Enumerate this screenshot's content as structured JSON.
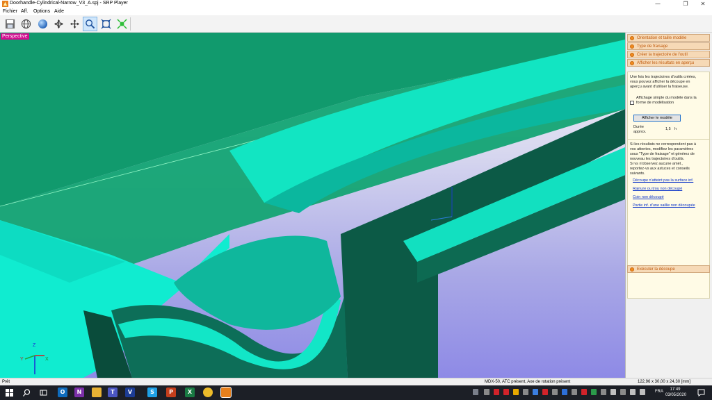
{
  "window": {
    "title": "Doorhandle-Cylindrical-Narrow_V3_A.spj - SRP Player",
    "minimize_icon": "minimize-icon",
    "maximize_icon": "restore-icon",
    "close_icon": "close-icon"
  },
  "menu": {
    "items": [
      "Fichier",
      "Aff.",
      "Options",
      "Aide"
    ]
  },
  "toolbar": {
    "buttons": [
      {
        "icon": "save-icon"
      },
      {
        "icon": "globe-grid-icon"
      },
      {
        "icon": "sphere-icon"
      },
      {
        "icon": "rotate-move-icon"
      },
      {
        "icon": "pan-icon"
      },
      {
        "icon": "zoom-icon"
      },
      {
        "icon": "fit-window-icon"
      },
      {
        "icon": "fit-selection-icon"
      }
    ],
    "active_index": 5
  },
  "viewport": {
    "view_label": "Perspective",
    "axis_labels": [
      "Z",
      "Y",
      "X"
    ]
  },
  "panel": {
    "steps": [
      "Orientation et taille modèle",
      "Type de fraisage",
      "Créer la trajectoire de l'outil",
      "Afficher les résultats en aperçu"
    ],
    "info_intro": [
      "Une fois les trajectoires d'outils créées,",
      "vous pouvez afficher la découpe en",
      "aperçu avant d'utiliser la fraiseuse."
    ],
    "checkbox_label": [
      "Affichage simple du modèle dans la",
      "forme de modélisation"
    ],
    "preview_button": "Afficher le modèle",
    "duration_label": [
      "Durée",
      "approx."
    ],
    "duration_value": "1,5",
    "duration_unit": "h",
    "advice_text": [
      "Si les résultats ne correspondent pas à",
      "vos attentes, modifiez les paramètres",
      "sous \"Type de fraisage\" et générez de",
      "nouveau les trajectoires d'outils.",
      "Si vs n'observez aucune amél.,",
      "reportez-vs aux astuces et conseils",
      "suivants."
    ],
    "links": [
      "Découpe n'atteint pas la surface inf.",
      "Rainure ou trou non découpé",
      "Coin non découpé",
      "Partie inf. d'une saillie non découpée"
    ],
    "execute_step": "Exécuter la découpe"
  },
  "status": {
    "left": "Prêt",
    "machine": "MDX-50, ATC présent, Axe de rotation présent",
    "dimensions": "122,96 x 30,00 x 24,30 [mm]"
  },
  "taskbar": {
    "clock_time": "17:49",
    "clock_date": "03/05/2020",
    "language": "FRA"
  },
  "colors": {
    "model_cyan": "#0fe6c6",
    "model_dark": "#0d5b48",
    "model_green": "#11855a",
    "step_orange": "#f08a1e",
    "link_blue": "#0a32c8"
  }
}
